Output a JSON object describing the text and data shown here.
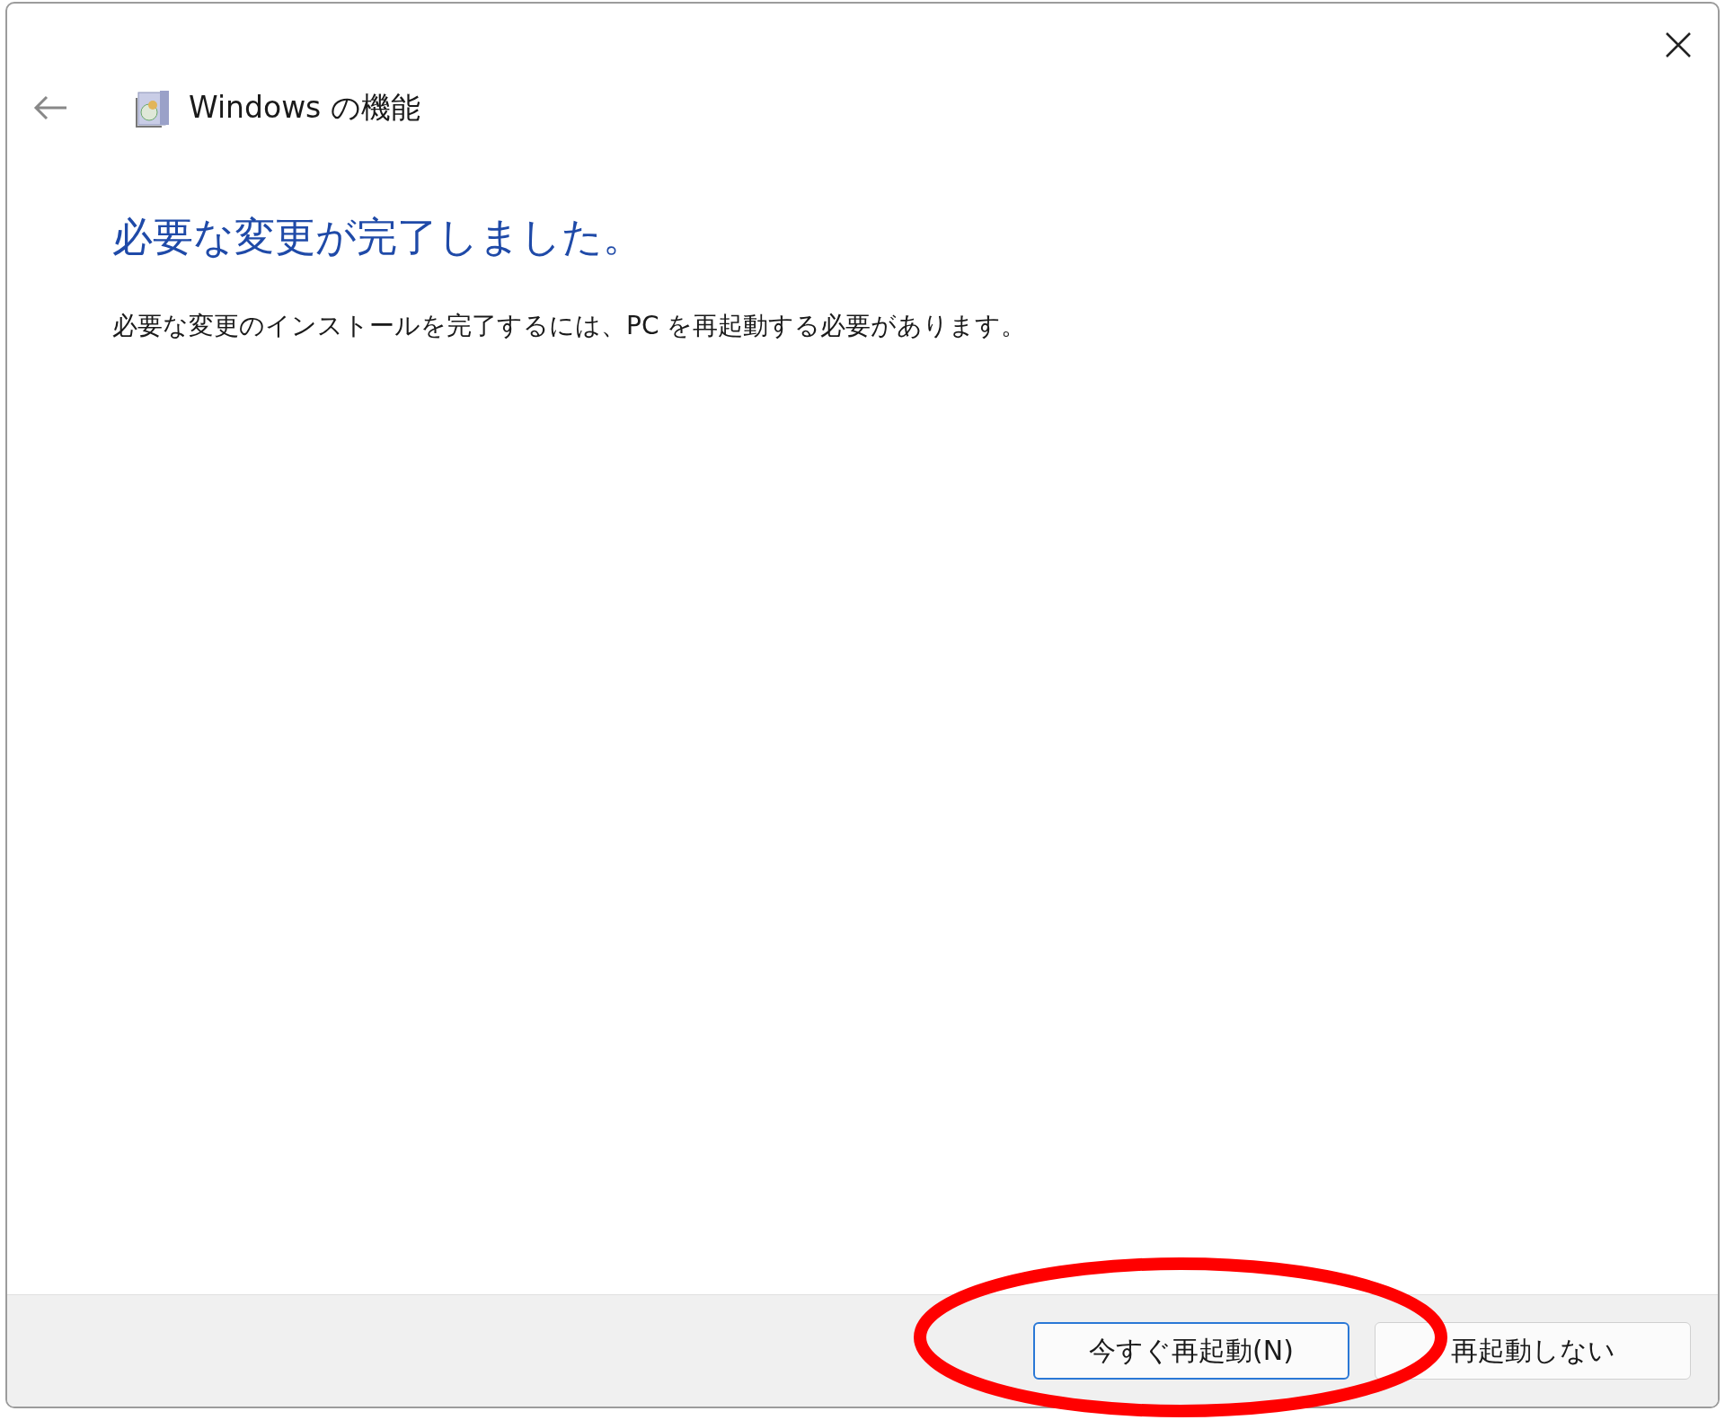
{
  "window": {
    "title": "Windows の機能"
  },
  "heading": "必要な変更が完了しました。",
  "message": "必要な変更のインストールを完了するには、PC を再起動する必要があります。",
  "buttons": [
    {
      "label": "今すぐ再起動(N)",
      "focused": true
    },
    {
      "label": "再起動しない",
      "focused": false
    }
  ]
}
